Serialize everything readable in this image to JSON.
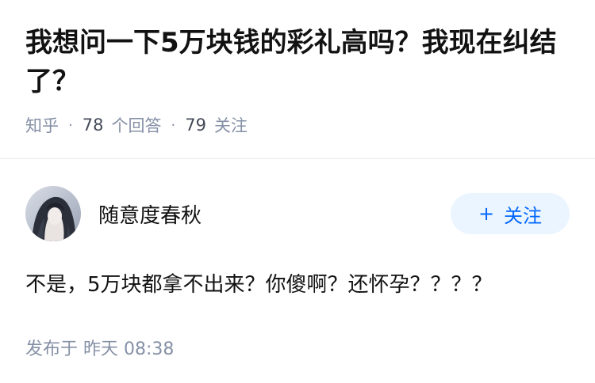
{
  "question": {
    "title": "我想问一下5万块钱的彩礼高吗？我现在纠结了？",
    "source": "知乎",
    "answer_count": "78",
    "answer_label": "个回答",
    "follower_count": "79",
    "follower_label": "关注"
  },
  "answer": {
    "author_name": "随意度春秋",
    "follow_plus": "+",
    "follow_label": "关注",
    "content": "不是，5万块都拿不出来？你傻啊？还怀孕？？？？",
    "posted_prefix": "发布于",
    "posted_time": "昨天 08:38"
  },
  "colors": {
    "accent": "#0066ff",
    "follow_bg": "#ebf5ff",
    "meta_gray": "#8590a6"
  }
}
